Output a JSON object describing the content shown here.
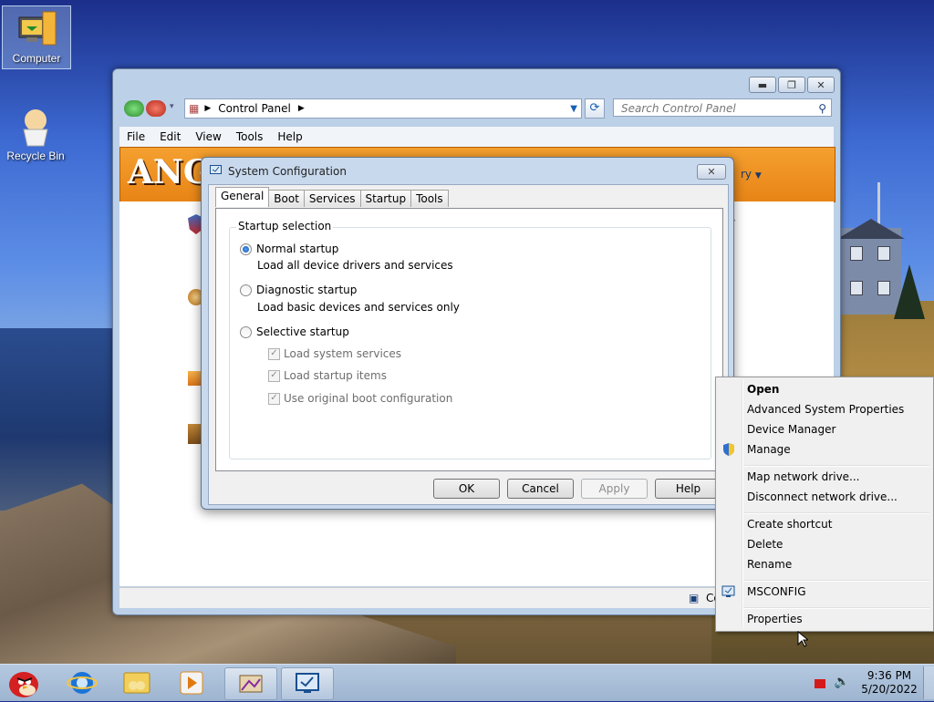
{
  "desktop": {
    "icons": [
      {
        "label": "Computer",
        "icon": "computer-icon"
      },
      {
        "label": "Recycle Bin",
        "icon": "recycle-bin-icon"
      }
    ]
  },
  "control_panel": {
    "breadcrumb": "Control Panel",
    "search_placeholder": "Search Control Panel",
    "menu": [
      "File",
      "Edit",
      "View",
      "Tools",
      "Help"
    ],
    "banner_text": "ANG",
    "banner_right_text": "ry",
    "status_text": "Co"
  },
  "dialog": {
    "title": "System Configuration",
    "tabs": [
      "General",
      "Boot",
      "Services",
      "Startup",
      "Tools"
    ],
    "active_tab": "General",
    "group_label": "Startup selection",
    "options": [
      {
        "label": "Normal startup",
        "description": "Load all device drivers and services",
        "selected": true
      },
      {
        "label": "Diagnostic startup",
        "description": "Load basic devices and services only",
        "selected": false
      },
      {
        "label": "Selective startup",
        "description": "",
        "selected": false
      }
    ],
    "selective_items": [
      {
        "label": "Load system services",
        "checked": true,
        "enabled": false
      },
      {
        "label": "Load startup items",
        "checked": true,
        "enabled": false
      },
      {
        "label": "Use original boot configuration",
        "checked": true,
        "enabled": false
      }
    ],
    "buttons": {
      "ok": "OK",
      "cancel": "Cancel",
      "apply": "Apply",
      "help": "Help"
    }
  },
  "context_menu": {
    "items": [
      {
        "label": "Open",
        "bold": true
      },
      {
        "label": "Advanced System Properties"
      },
      {
        "label": "Device Manager"
      },
      {
        "label": "Manage",
        "icon": "uac-shield-icon"
      },
      {
        "label": "Map network drive..."
      },
      {
        "label": "Disconnect network drive..."
      },
      {
        "label": "Create shortcut"
      },
      {
        "label": "Delete"
      },
      {
        "label": "Rename"
      },
      {
        "label": "MSCONFIG",
        "icon": "msconfig-icon"
      },
      {
        "label": "Properties"
      }
    ]
  },
  "taskbar": {
    "start_icon": "angry-bird-start-icon",
    "pinned": [
      "internet-explorer-icon",
      "folder-icon",
      "media-player-icon",
      "control-panel-icon",
      "system-configuration-icon"
    ],
    "time": "9:36 PM",
    "date": "5/20/2022"
  },
  "colors": {
    "banner": "#f08a1c",
    "accent": "#1a5fb4"
  }
}
